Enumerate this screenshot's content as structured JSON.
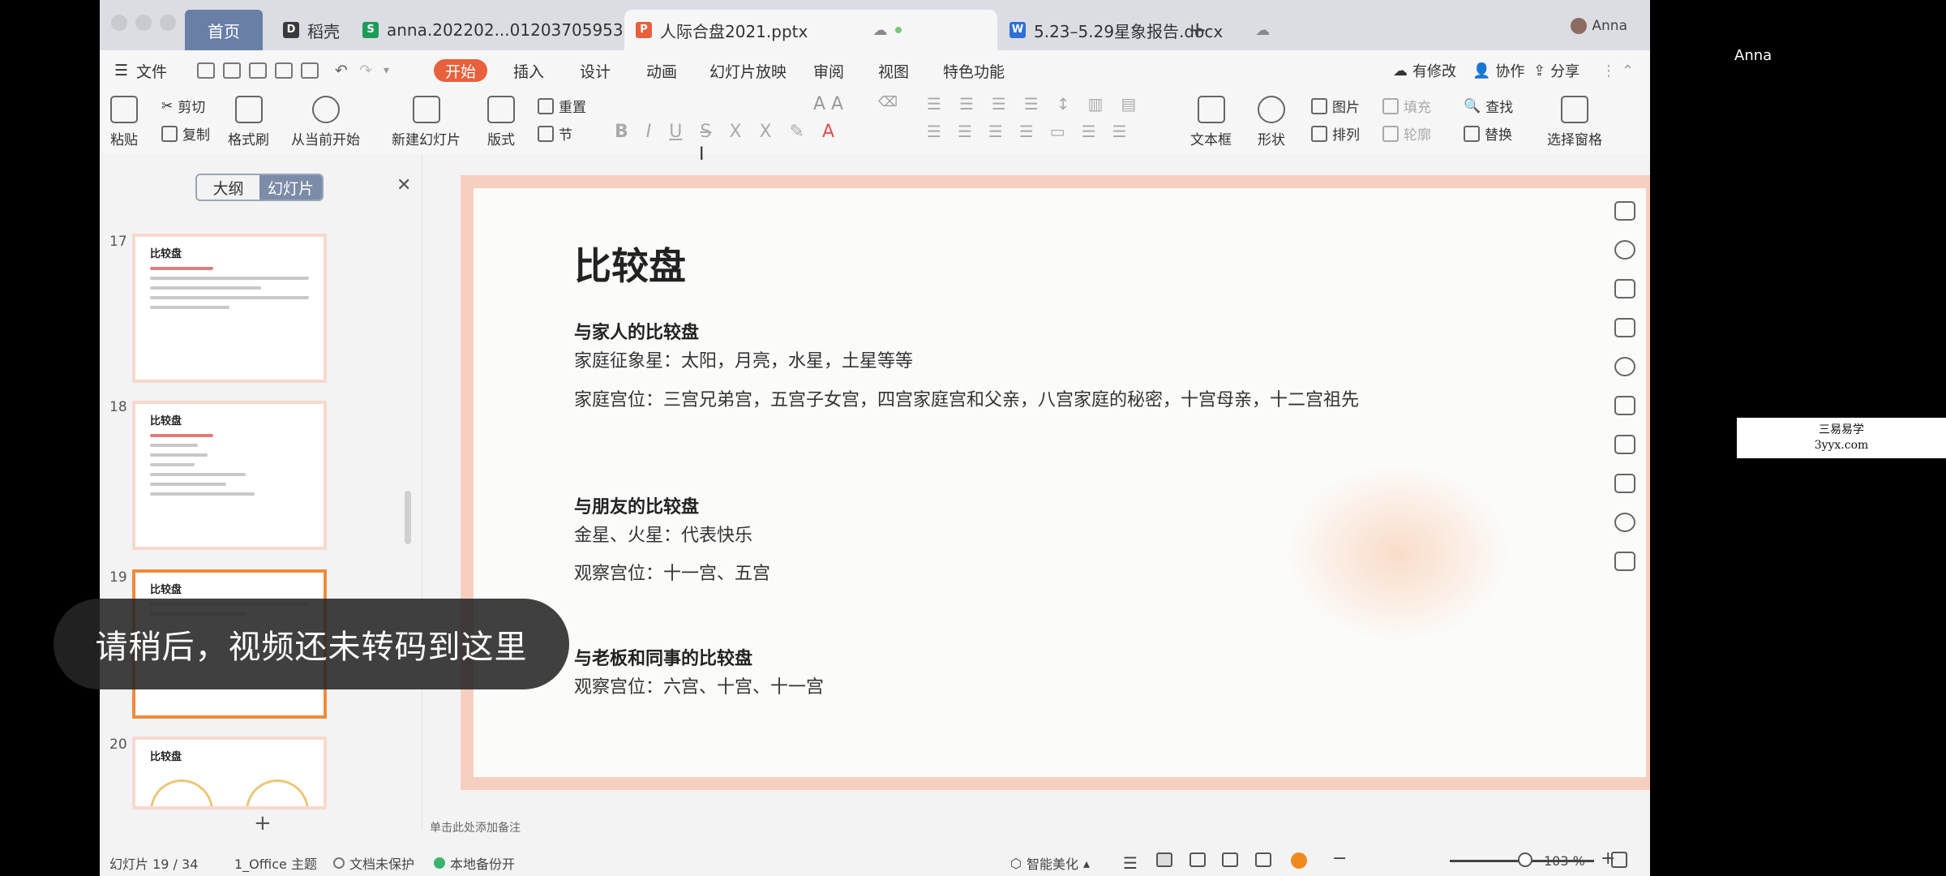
{
  "window": {
    "user_name": "Anna"
  },
  "tabs": [
    {
      "label": "首页"
    },
    {
      "label": "稻壳"
    },
    {
      "label": "anna.202202...01203705953"
    },
    {
      "label": "人际合盘2021.pptx"
    },
    {
      "label": "5.23–5.29星象报告.docx"
    }
  ],
  "menu": {
    "file": "文件",
    "items": [
      "开始",
      "插入",
      "设计",
      "动画",
      "幻灯片放映",
      "审阅",
      "视图",
      "特色功能"
    ],
    "right": [
      "有修改",
      "协作",
      "分享"
    ]
  },
  "ribbon": {
    "paste": "粘贴",
    "cut": "剪切",
    "copy": "复制",
    "format_painter": "格式刷",
    "from_current": "从当前开始",
    "new_slide": "新建幻灯片",
    "layout": "版式",
    "reset": "重置",
    "section": "节",
    "text_box": "文本框",
    "shape": "形状",
    "picture": "图片",
    "fill": "填充",
    "arrange": "排列",
    "outline": "轮廓",
    "find": "查找",
    "replace": "替换",
    "select_pane": "选择窗格"
  },
  "left_panel": {
    "seg_outline": "大纲",
    "seg_slides": "幻灯片",
    "thumbs": [
      {
        "num": "17",
        "title": "比较盘"
      },
      {
        "num": "18",
        "title": "比较盘"
      },
      {
        "num": "19",
        "title": "比较盘"
      },
      {
        "num": "20",
        "title": "比较盘"
      }
    ]
  },
  "slide": {
    "title": "比较盘",
    "sections": [
      {
        "heading": "与家人的比较盘",
        "lines": [
          "家庭征象星：太阳，月亮，水星，土星等等",
          "家庭宫位：三宫兄弟宫，五宫子女宫，四宫家庭宫和父亲，八宫家庭的秘密，十宫母亲，十二宫祖先"
        ]
      },
      {
        "heading": "与朋友的比较盘",
        "lines": [
          "金星、火星：代表快乐",
          "观察宫位：十一宫、五宫"
        ]
      },
      {
        "heading": "与老板和同事的比较盘",
        "lines": [
          "观察宫位：六宫、十宫、十一宫"
        ]
      }
    ]
  },
  "notes_placeholder": "单击此处添加备注",
  "status": {
    "slide_counter": "幻灯片 19 / 34",
    "theme": "1_Office 主题",
    "protect": "文档未保护",
    "backup": "本地备份开",
    "beautify": "智能美化",
    "zoom": "103 %",
    "zoom_fraction": 0.52
  },
  "overlay": {
    "toast": "请稍后，视频还未转码到这里",
    "watermark_line1": "三易易学",
    "watermark_line2": "3yyx.com"
  },
  "colors": {
    "accent": "#e8603c",
    "selected_border": "#f08a3c",
    "home_tab": "#6a7fa6"
  }
}
